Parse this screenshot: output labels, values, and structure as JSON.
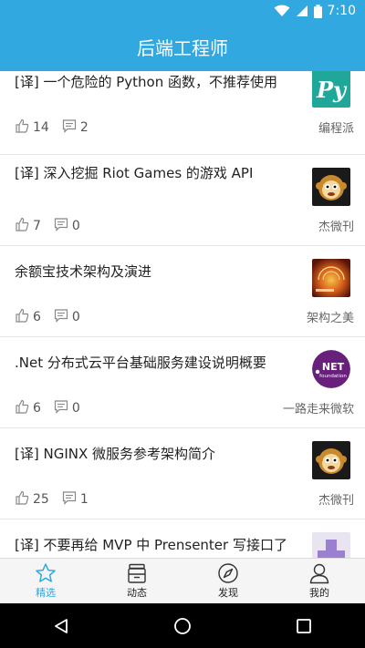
{
  "status_bar": {
    "time": "7:10",
    "icons": [
      "wifi-icon",
      "signal-icon",
      "battery-icon"
    ]
  },
  "app_bar": {
    "title": "后端工程师"
  },
  "articles": [
    {
      "title": "[译] 一个危险的 Python 函数，不推荐使用",
      "likes": "14",
      "comments": "2",
      "source": "编程派",
      "thumb": "python-logo"
    },
    {
      "title": "[译] 深入挖掘 Riot Games 的游戏 API",
      "likes": "7",
      "comments": "0",
      "source": "杰微刊",
      "thumb": "monkey-avatar"
    },
    {
      "title": "余额宝技术架构及演进",
      "likes": "6",
      "comments": "0",
      "source": "架构之美",
      "thumb": "architecture-book-cover"
    },
    {
      "title": ".Net 分布式云平台基础服务建设说明概要",
      "likes": "6",
      "comments": "0",
      "source": "一路走来微软",
      "thumb": "dotnet-foundation-logo",
      "thumb_text_1": "NET",
      "thumb_text_2": "foundation"
    },
    {
      "title": "[译] NGINX 微服务参考架构简介",
      "likes": "25",
      "comments": "1",
      "source": "杰微刊",
      "thumb": "monkey-avatar"
    },
    {
      "title": "[译] 不要再给 MVP 中 Prensenter 写接口了",
      "likes": "",
      "comments": "",
      "source": "",
      "thumb": "purple-block-avatar"
    }
  ],
  "tabs": [
    {
      "label": "精选",
      "icon": "star-icon",
      "active": true
    },
    {
      "label": "动态",
      "icon": "inbox-icon",
      "active": false
    },
    {
      "label": "发现",
      "icon": "compass-icon",
      "active": false
    },
    {
      "label": "我的",
      "icon": "person-icon",
      "active": false
    }
  ],
  "colors": {
    "primary": "#31a8e0",
    "python_teal": "#1fa89a",
    "dotnet_purple": "#68217a"
  },
  "nav": [
    "back-icon",
    "home-icon",
    "recents-icon"
  ]
}
